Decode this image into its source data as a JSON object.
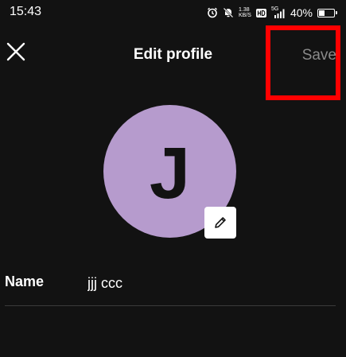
{
  "status_bar": {
    "time": "15:43",
    "network_speed_value": "1.38",
    "network_speed_unit": "KB/S",
    "signal_label": "5G",
    "battery_percent": "40%",
    "battery_level": 0.4,
    "icons": [
      "alarm-icon",
      "mute-icon",
      "network-speed",
      "hd-icon",
      "signal-icon",
      "battery-icon"
    ]
  },
  "header": {
    "close_icon": "close-icon",
    "title": "Edit profile",
    "save_label": "Save"
  },
  "avatar": {
    "initial": "J",
    "color": "#b69bcd",
    "edit_icon": "pencil-icon"
  },
  "profile": {
    "name_label": "Name",
    "name_value": "jjj ccc"
  },
  "colors": {
    "background": "#121212",
    "highlight": "#ff0000",
    "save_disabled": "#8a8a8a"
  }
}
